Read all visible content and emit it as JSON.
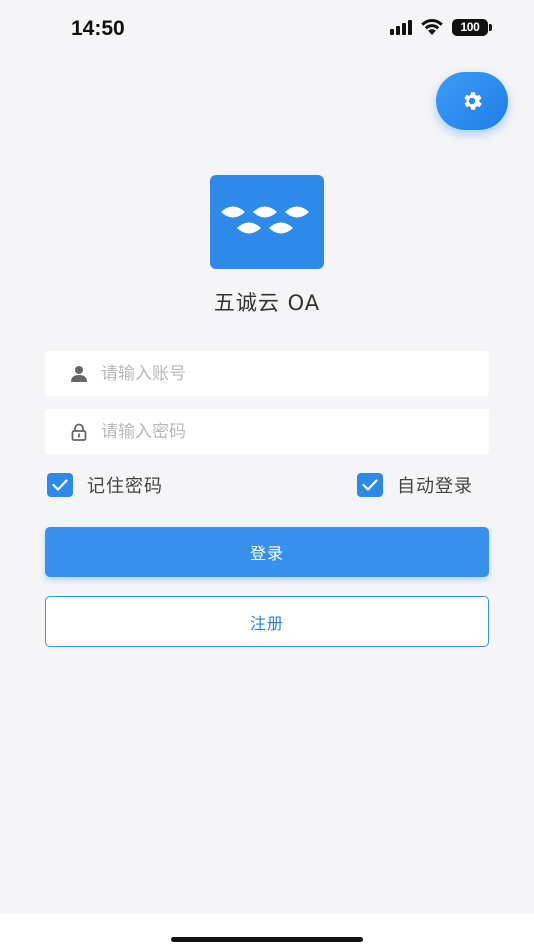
{
  "status_bar": {
    "time": "14:50",
    "battery": "100",
    "icons": [
      "signal-icon",
      "wifi-icon",
      "battery-icon"
    ]
  },
  "settings": {
    "icon": "gear-icon"
  },
  "app": {
    "name": "五诚云 OA",
    "logo_icon": "leaves-logo-icon"
  },
  "form": {
    "account": {
      "placeholder": "请输入账号",
      "value": "",
      "icon": "user-icon"
    },
    "password": {
      "placeholder": "请输入密码",
      "value": "",
      "icon": "lock-icon"
    },
    "remember_password": {
      "label": "记住密码",
      "checked": true
    },
    "auto_login": {
      "label": "自动登录",
      "checked": true
    },
    "login_label": "登录",
    "register_label": "注册"
  },
  "colors": {
    "accent": "#3690ec",
    "logo_bg": "#2e8ae8",
    "background": "#f5f5f7"
  }
}
